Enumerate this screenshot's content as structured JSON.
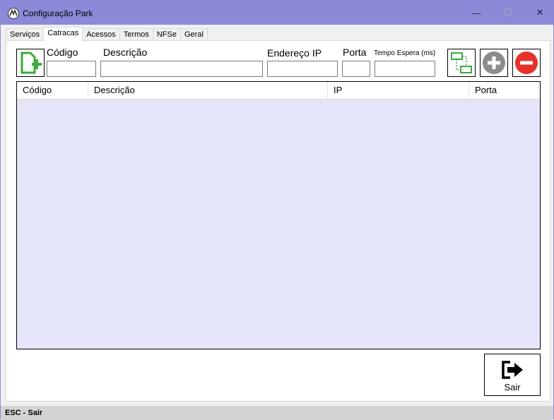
{
  "window": {
    "title": "Configuração Park",
    "minimize_glyph": "—",
    "maximize_glyph": "☐",
    "close_glyph": "✕"
  },
  "tabs": [
    {
      "label": "Serviços",
      "active": false
    },
    {
      "label": "Catracas",
      "active": true
    },
    {
      "label": "Acessos",
      "active": false
    },
    {
      "label": "Termos",
      "active": false
    },
    {
      "label": "NFSe",
      "active": false
    },
    {
      "label": "Geral",
      "active": false
    }
  ],
  "form": {
    "codigo_label": "Código",
    "descricao_label": "Descrição",
    "endereco_ip_label": "Endereço IP",
    "porta_label": "Porta",
    "tempo_espera_label": "Tempo Espera (ms)",
    "codigo_value": "",
    "descricao_value": "",
    "endereco_ip_value": "",
    "porta_value": "",
    "tempo_espera_value": ""
  },
  "icons": {
    "new": "new-document-icon",
    "link": "linked-records-icon",
    "add": "plus-circle-icon",
    "remove": "minus-circle-icon",
    "exit": "exit-arrow-icon",
    "green": "#3caa3c",
    "gray": "#8c8c8c",
    "red": "#e8302a"
  },
  "grid": {
    "columns": [
      "Código",
      "Descrição",
      "IP",
      "Porta"
    ],
    "rows": [],
    "background": "#e4e5f8"
  },
  "buttons": {
    "sair_label": "Sair"
  },
  "statusbar": {
    "text": "ESC - Sair"
  }
}
